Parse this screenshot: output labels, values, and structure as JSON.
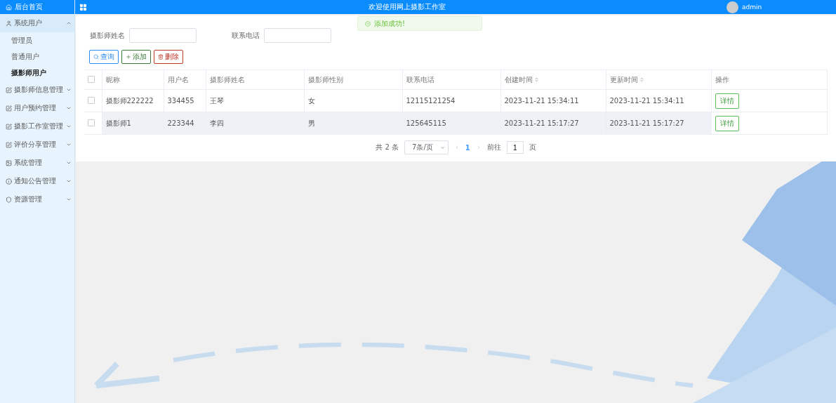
{
  "header": {
    "home_label": "后台首页",
    "title": "欢迎使用网上摄影工作室",
    "user": "admin"
  },
  "toast": {
    "message": "添加成功!"
  },
  "sidebar": {
    "items": [
      {
        "label": "系统用户",
        "expanded": true,
        "children": [
          {
            "label": "管理员",
            "selected": false
          },
          {
            "label": "普通用户",
            "selected": false
          },
          {
            "label": "摄影师用户",
            "selected": true
          }
        ]
      },
      {
        "label": "摄影师信息管理",
        "expanded": false
      },
      {
        "label": "用户预约管理",
        "expanded": false
      },
      {
        "label": "摄影工作室管理",
        "expanded": false
      },
      {
        "label": "评价分享管理",
        "expanded": false
      },
      {
        "label": "系统管理",
        "expanded": false
      },
      {
        "label": "通知公告管理",
        "expanded": false
      },
      {
        "label": "资源管理",
        "expanded": false
      }
    ]
  },
  "filters": [
    {
      "label": "摄影师姓名"
    },
    {
      "label": "联系电话"
    }
  ],
  "buttons": [
    {
      "kind": "search",
      "label": "查询"
    },
    {
      "kind": "add",
      "label": "添加"
    },
    {
      "kind": "delete",
      "label": "删除"
    }
  ],
  "table": {
    "select_all_checked": false,
    "columns": [
      {
        "label": "昵称",
        "sortable": false
      },
      {
        "label": "用户名",
        "sortable": false
      },
      {
        "label": "摄影师姓名",
        "sortable": false
      },
      {
        "label": "摄影师性别",
        "sortable": false
      },
      {
        "label": "联系电话",
        "sortable": false
      },
      {
        "label": "创建时间",
        "sortable": true
      },
      {
        "label": "更新时间",
        "sortable": true
      },
      {
        "label": "操作",
        "sortable": false
      }
    ],
    "rows": [
      {
        "checked": false,
        "highlighted": false,
        "cells": [
          "摄影师222222",
          "334455",
          "王琴",
          "女",
          "12115121254",
          "2023-11-21 15:34:11",
          "2023-11-21 15:34:11"
        ],
        "action": "详情"
      },
      {
        "checked": false,
        "highlighted": true,
        "cells": [
          "摄影师1",
          "223344",
          "李四",
          "男",
          "125645115",
          "2023-11-21 15:17:27",
          "2023-11-21 15:17:27"
        ],
        "action": "详情"
      }
    ]
  },
  "pagination": {
    "total": "共 2 条",
    "page_size": "7条/页",
    "pages": [
      {
        "label": "1",
        "selected": true
      }
    ],
    "goto_label": "前往",
    "goto_value": "1",
    "goto_suffix": "页"
  }
}
